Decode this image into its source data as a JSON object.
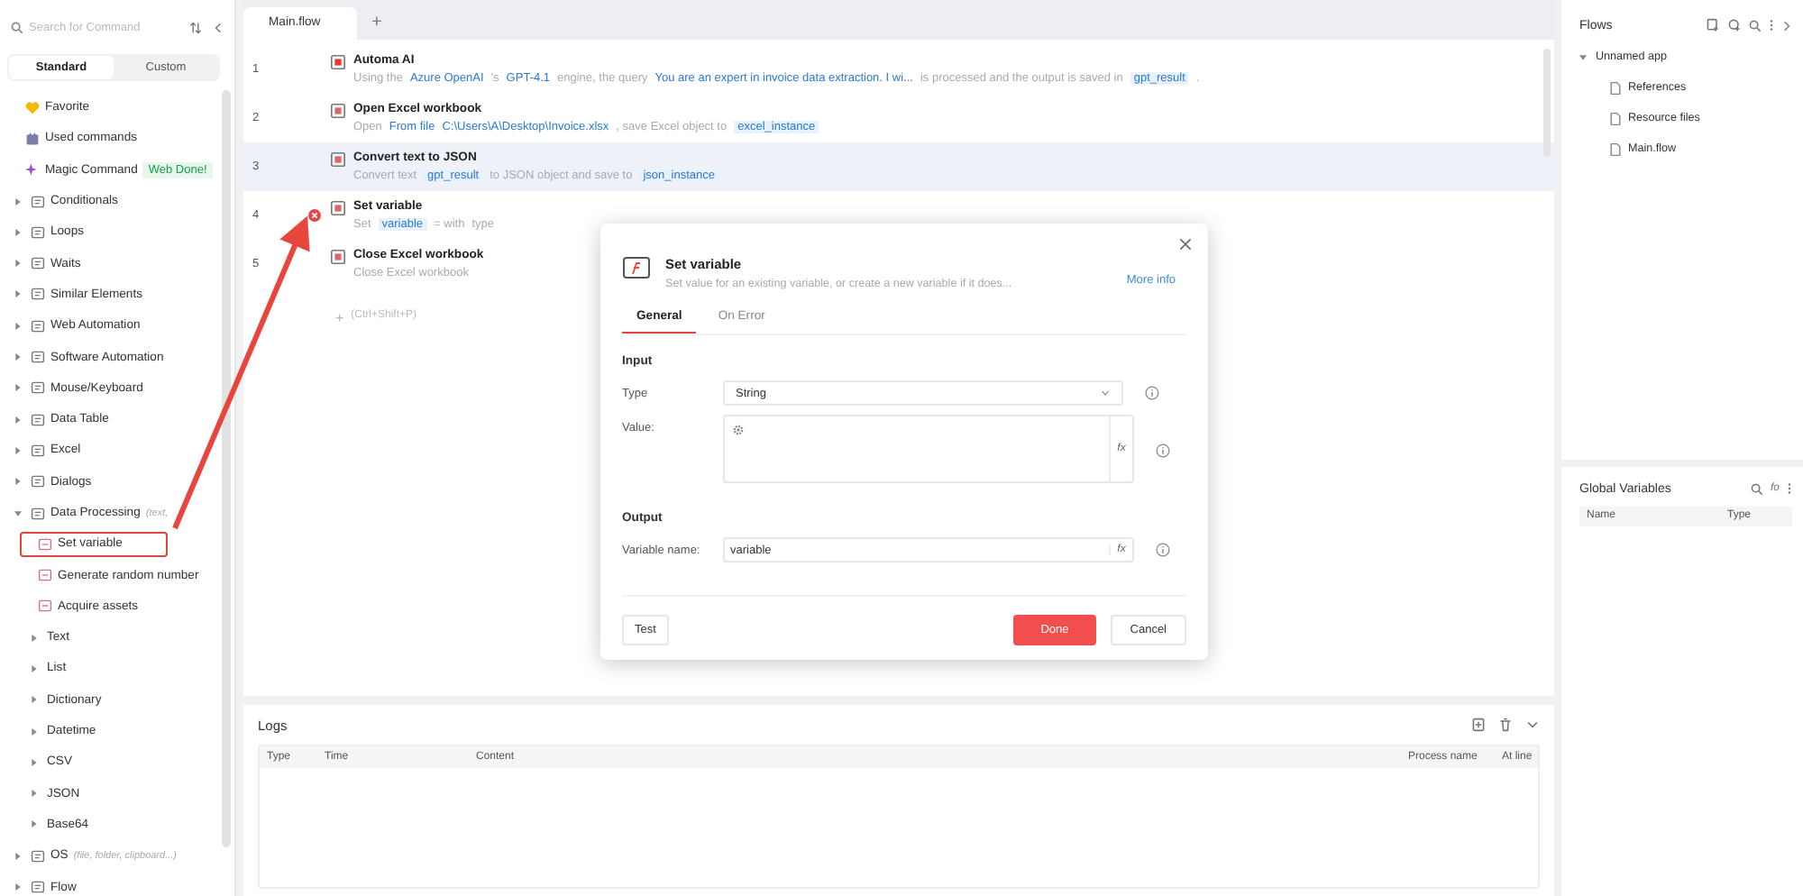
{
  "sidebar": {
    "search": {
      "placeholder": "Search for Command"
    },
    "tabs": [
      {
        "label": "Standard",
        "selected": true
      },
      {
        "label": "Custom",
        "selected": false
      }
    ],
    "items": [
      {
        "kind": "pinned",
        "label": "Favorite"
      },
      {
        "kind": "pinned",
        "label": "Used commands"
      },
      {
        "kind": "pinned",
        "label": "Magic Command",
        "badge": "Web Done!"
      },
      {
        "kind": "category",
        "label": "Conditionals",
        "expanded": false
      },
      {
        "kind": "category",
        "label": "Loops",
        "expanded": false
      },
      {
        "kind": "category",
        "label": "Waits",
        "expanded": false
      },
      {
        "kind": "category",
        "label": "Similar Elements",
        "expanded": false
      },
      {
        "kind": "category",
        "label": "Web Automation",
        "expanded": false
      },
      {
        "kind": "category",
        "label": "Software Automation",
        "expanded": false
      },
      {
        "kind": "category",
        "label": "Mouse/Keyboard",
        "expanded": false
      },
      {
        "kind": "category",
        "label": "Data Table",
        "expanded": false
      },
      {
        "kind": "category",
        "label": "Excel",
        "expanded": false
      },
      {
        "kind": "category",
        "label": "Dialogs",
        "expanded": false
      },
      {
        "kind": "category",
        "label": "Data Processing",
        "hint": "(text,",
        "expanded": true,
        "children": [
          {
            "kind": "command",
            "label": "Set variable",
            "highlighted": true
          },
          {
            "kind": "command",
            "label": "Generate random number",
            "highlighted": false
          },
          {
            "kind": "command",
            "label": "Acquire assets",
            "highlighted": false
          },
          {
            "kind": "group",
            "label": "Text",
            "expanded": false
          },
          {
            "kind": "group",
            "label": "List",
            "expanded": false
          },
          {
            "kind": "group",
            "label": "Dictionary",
            "expanded": false
          },
          {
            "kind": "group",
            "label": "Datetime",
            "expanded": false
          },
          {
            "kind": "group",
            "label": "CSV",
            "expanded": false
          },
          {
            "kind": "group",
            "label": "JSON",
            "expanded": false
          },
          {
            "kind": "group",
            "label": "Base64",
            "expanded": false
          }
        ]
      },
      {
        "kind": "category",
        "label": "OS",
        "hint": "(file, folder, clipboard...)",
        "expanded": false
      },
      {
        "kind": "category",
        "label": "Flow",
        "expanded": false
      }
    ]
  },
  "editor": {
    "tabs": [
      {
        "label": "Main.flow",
        "selected": true
      }
    ],
    "add_tab": "+",
    "steps": [
      {
        "number": "1",
        "title": "Automa AI",
        "selected": false,
        "error": false,
        "parts": [
          {
            "kind": "text",
            "text": "Using the"
          },
          {
            "kind": "token",
            "text": "Azure OpenAI"
          },
          {
            "kind": "text",
            "text": "'s"
          },
          {
            "kind": "token",
            "text": "GPT-4.1"
          },
          {
            "kind": "text",
            "text": "engine, the query"
          },
          {
            "kind": "token",
            "text": "You are an expert in invoice data extraction. I wi..."
          },
          {
            "kind": "text",
            "text": "is processed and the output is saved in"
          },
          {
            "kind": "var",
            "text": "gpt_result"
          },
          {
            "kind": "text",
            "text": "."
          }
        ]
      },
      {
        "number": "2",
        "title": "Open Excel workbook",
        "selected": false,
        "error": false,
        "parts": [
          {
            "kind": "text",
            "text": "Open"
          },
          {
            "kind": "token",
            "text": "From file"
          },
          {
            "kind": "token",
            "text": "C:\\Users\\A\\Desktop\\Invoice.xlsx"
          },
          {
            "kind": "text",
            "text": ", save Excel object to"
          },
          {
            "kind": "var",
            "text": "excel_instance"
          }
        ]
      },
      {
        "number": "3",
        "title": "Convert text to JSON",
        "selected": true,
        "error": false,
        "parts": [
          {
            "kind": "text",
            "text": "Convert text"
          },
          {
            "kind": "var",
            "text": "gpt_result"
          },
          {
            "kind": "text",
            "text": "to JSON object and save to"
          },
          {
            "kind": "var",
            "text": "json_instance"
          }
        ]
      },
      {
        "number": "4",
        "title": "Set variable",
        "selected": false,
        "error": true,
        "parts": [
          {
            "kind": "text",
            "text": "Set"
          },
          {
            "kind": "var",
            "text": "variable"
          },
          {
            "kind": "text",
            "text": "= with"
          },
          {
            "kind": "text",
            "text": "type"
          }
        ]
      },
      {
        "number": "5",
        "title": "Close Excel workbook",
        "selected": false,
        "error": false,
        "parts": [
          {
            "kind": "text",
            "text": "Close Excel workbook"
          }
        ]
      }
    ],
    "add_step": {
      "plus": "+",
      "shortcut": "(Ctrl+Shift+P)"
    }
  },
  "dialog": {
    "title": "Set variable",
    "subtitle": "Set value for an existing variable, or create a new variable if it does...",
    "more_info": "More info",
    "tabs": [
      {
        "label": "General",
        "selected": true
      },
      {
        "label": "On Error",
        "selected": false
      }
    ],
    "input_section": "Input",
    "type_label": "Type",
    "type_value": "String",
    "value_label": "Value:",
    "value_fx": "fx",
    "name_fx": "fx",
    "output_section": "Output",
    "name_label": "Variable name:",
    "name_value": "variable",
    "buttons": {
      "test": "Test",
      "done": "Done",
      "cancel": "Cancel"
    }
  },
  "logs": {
    "title": "Logs",
    "columns": [
      "Type",
      "Time",
      "Content",
      "Process name",
      "At line"
    ]
  },
  "flows": {
    "title": "Flows",
    "tree": [
      {
        "label": "Unnamed app",
        "expanded": true,
        "children": [
          {
            "label": "References"
          },
          {
            "label": "Resource files"
          },
          {
            "label": "Main.flow"
          }
        ]
      }
    ]
  },
  "globals": {
    "title": "Global Variables",
    "fx_icon": "fo",
    "columns": [
      "Name",
      "Type"
    ]
  }
}
